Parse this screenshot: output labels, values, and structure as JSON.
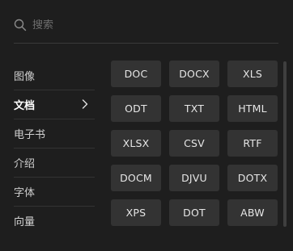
{
  "search": {
    "placeholder": "搜索",
    "icon": "search-icon"
  },
  "sidebar": {
    "items": [
      {
        "label": "图像",
        "active": false
      },
      {
        "label": "文档",
        "active": true,
        "icon": "chevron-right-icon"
      },
      {
        "label": "电子书",
        "active": false
      },
      {
        "label": "介绍",
        "active": false
      },
      {
        "label": "字体",
        "active": false
      },
      {
        "label": "向量",
        "active": false
      }
    ]
  },
  "formats": [
    "DOC",
    "DOCX",
    "XLS",
    "ODT",
    "TXT",
    "HTML",
    "XLSX",
    "CSV",
    "RTF",
    "DOCM",
    "DJVU",
    "DOTX",
    "XPS",
    "DOT",
    "ABW"
  ],
  "colors": {
    "background": "#1e1e1e",
    "button": "#333333",
    "divider": "#3a3a3a",
    "text": "#d8d8d8",
    "placeholder": "#6e6e6e"
  }
}
